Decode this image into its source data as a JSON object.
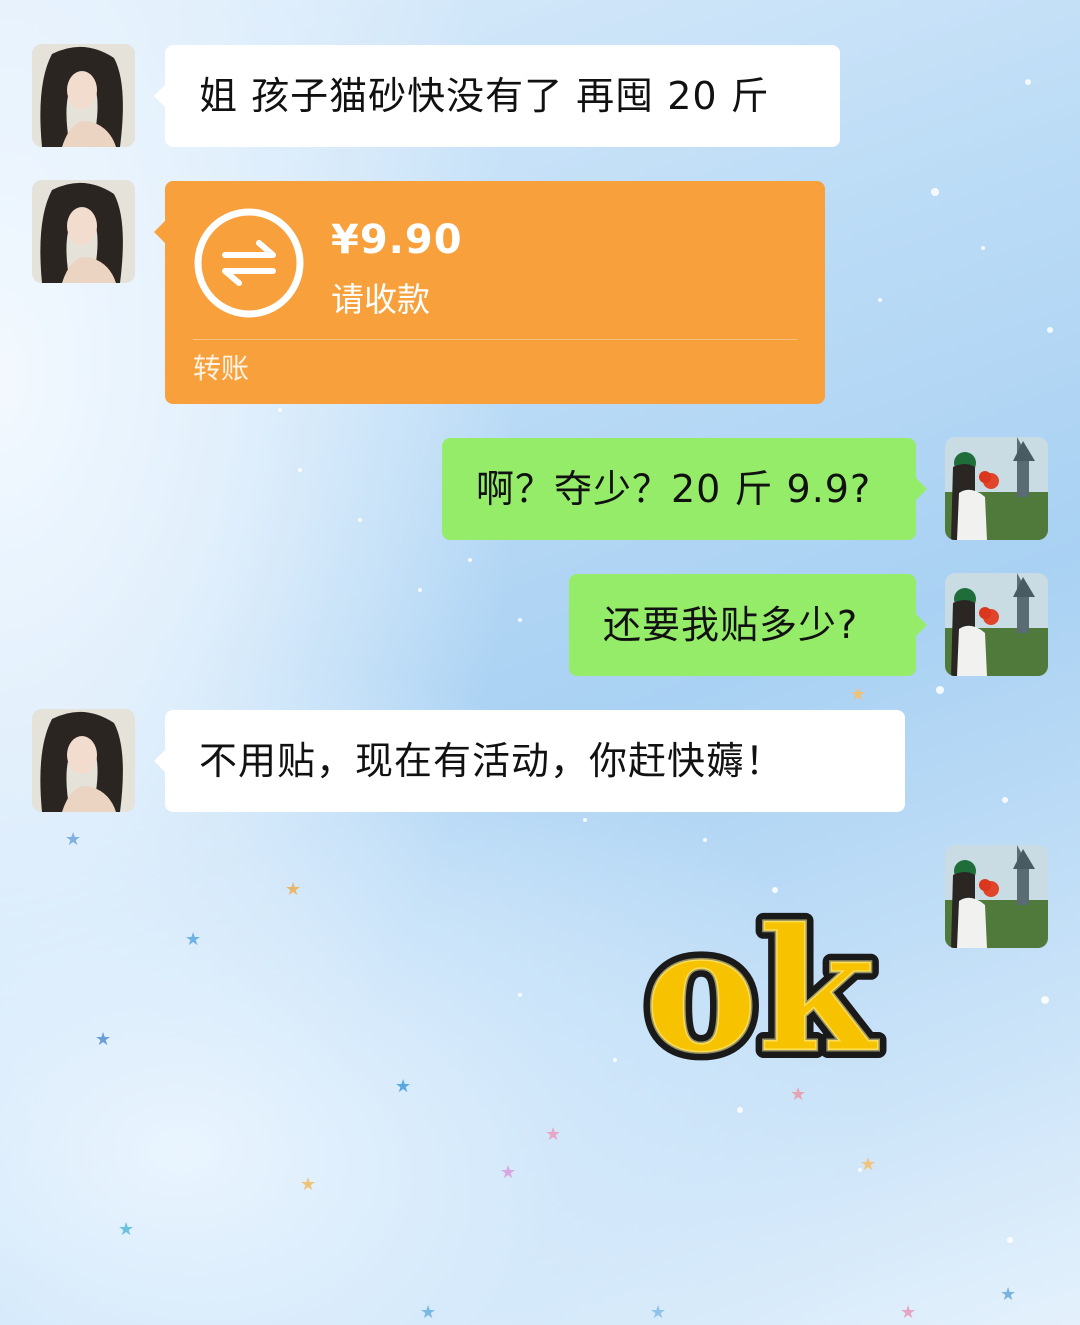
{
  "messages": [
    {
      "sender": "contact",
      "type": "text",
      "text": "姐 孩子猫砂快没有了 再囤 20 斤"
    },
    {
      "sender": "contact",
      "type": "transfer",
      "amount": "¥9.90",
      "status": "请收款",
      "label": "转账"
    },
    {
      "sender": "self",
      "type": "text",
      "text": "啊？夺少？20 斤 9.9?"
    },
    {
      "sender": "self",
      "type": "text",
      "text": "还要我贴多少?"
    },
    {
      "sender": "contact",
      "type": "text",
      "text": "不用贴，现在有活动，你赶快薅！"
    },
    {
      "sender": "self",
      "type": "sticker",
      "sticker_text": "ok"
    }
  ],
  "colors": {
    "incoming_bubble": "#ffffff",
    "outgoing_bubble": "#95ec69",
    "transfer_card": "#f8a03c",
    "sticker_fill": "#f7c300"
  },
  "icons": {
    "transfer": "transfer-arrows-icon"
  }
}
